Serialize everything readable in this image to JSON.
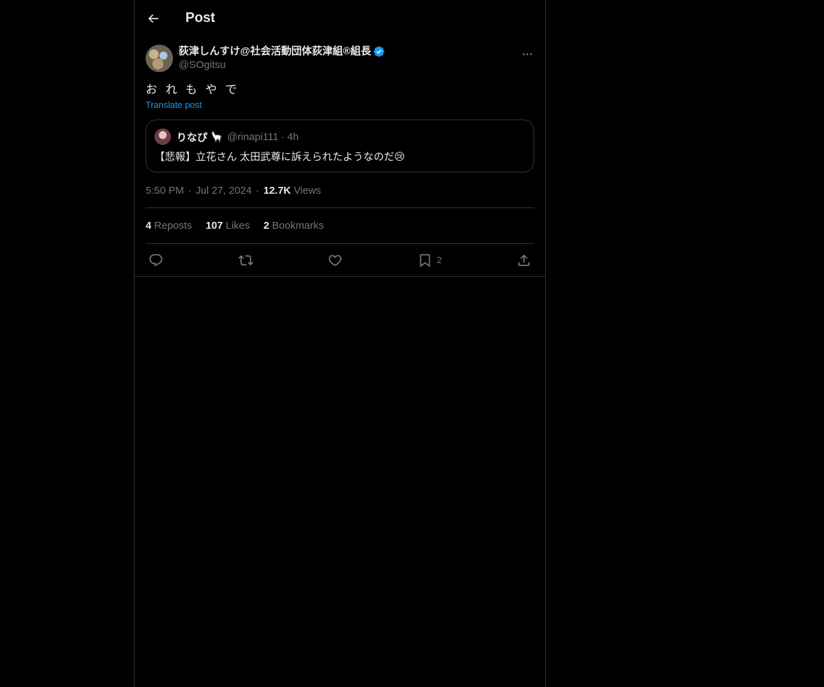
{
  "header": {
    "title": "Post",
    "back_icon": "arrow-left-icon"
  },
  "post": {
    "author": {
      "display_name": "荻津しんすけ@社会活動団体荻津組®組長",
      "handle": "@SOgitsu",
      "verified": true
    },
    "text": "おれもやで",
    "translate_label": "Translate post",
    "quote": {
      "display_name": "りなぴ",
      "emoji": "🦙",
      "handle": "@rinapi111",
      "separator": "·",
      "time": "4h",
      "text": "【悲報】立花さん 太田武尊に訴えられたようなのだ😢"
    },
    "meta": {
      "time": "5:50 PM",
      "separator": "·",
      "date": "Jul 27, 2024",
      "views_count": "12.7K",
      "views_label": "Views"
    },
    "stats": {
      "reposts_count": "4",
      "reposts_label": "Reposts",
      "likes_count": "107",
      "likes_label": "Likes",
      "bookmarks_count": "2",
      "bookmarks_label": "Bookmarks"
    },
    "actions": {
      "bookmark_count": "2"
    }
  },
  "colors": {
    "background": "#000000",
    "text_primary": "#e7e9ea",
    "text_secondary": "#71767b",
    "accent": "#1d9bf0",
    "border": "#2f3336"
  }
}
